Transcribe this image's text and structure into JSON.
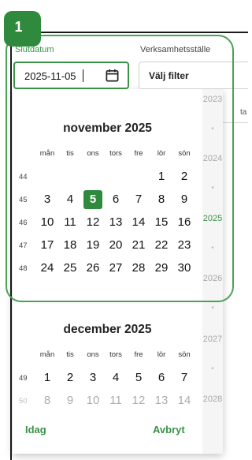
{
  "step": {
    "number": "1"
  },
  "filters": {
    "end_date": {
      "label": "Slutdatum",
      "value": "2025-11-05"
    },
    "business_unit": {
      "label": "Verksamhetsställe",
      "value": "Välj filter"
    },
    "truncated_column": "ta"
  },
  "calendar": {
    "weekdays": [
      "mån",
      "tis",
      "ons",
      "tors",
      "fre",
      "lör",
      "sön"
    ],
    "months": [
      {
        "title": "november 2025",
        "weeks": [
          {
            "week": "44",
            "days": [
              "",
              "",
              "",
              "",
              "",
              "1",
              "2"
            ]
          },
          {
            "week": "45",
            "days": [
              "3",
              "4",
              "5",
              "6",
              "7",
              "8",
              "9"
            ]
          },
          {
            "week": "46",
            "days": [
              "10",
              "11",
              "12",
              "13",
              "14",
              "15",
              "16"
            ]
          },
          {
            "week": "47",
            "days": [
              "17",
              "18",
              "19",
              "20",
              "21",
              "22",
              "23"
            ]
          },
          {
            "week": "48",
            "days": [
              "24",
              "25",
              "26",
              "27",
              "28",
              "29",
              "30"
            ]
          }
        ]
      },
      {
        "title": "december 2025",
        "weeks": [
          {
            "week": "49",
            "days": [
              "1",
              "2",
              "3",
              "4",
              "5",
              "6",
              "7"
            ]
          },
          {
            "week": "50",
            "days": [
              "8",
              "9",
              "10",
              "11",
              "12",
              "13",
              "14"
            ]
          }
        ]
      }
    ],
    "selected_day": "5",
    "years": [
      "2023",
      "2024",
      "2025",
      "2026",
      "2027",
      "2028"
    ],
    "active_year": "2025",
    "today_button": "Idag",
    "cancel_button": "Avbryt"
  },
  "colors": {
    "accent": "#3a9248",
    "selected": "#2f8a3e",
    "ring": "#4aa255"
  }
}
